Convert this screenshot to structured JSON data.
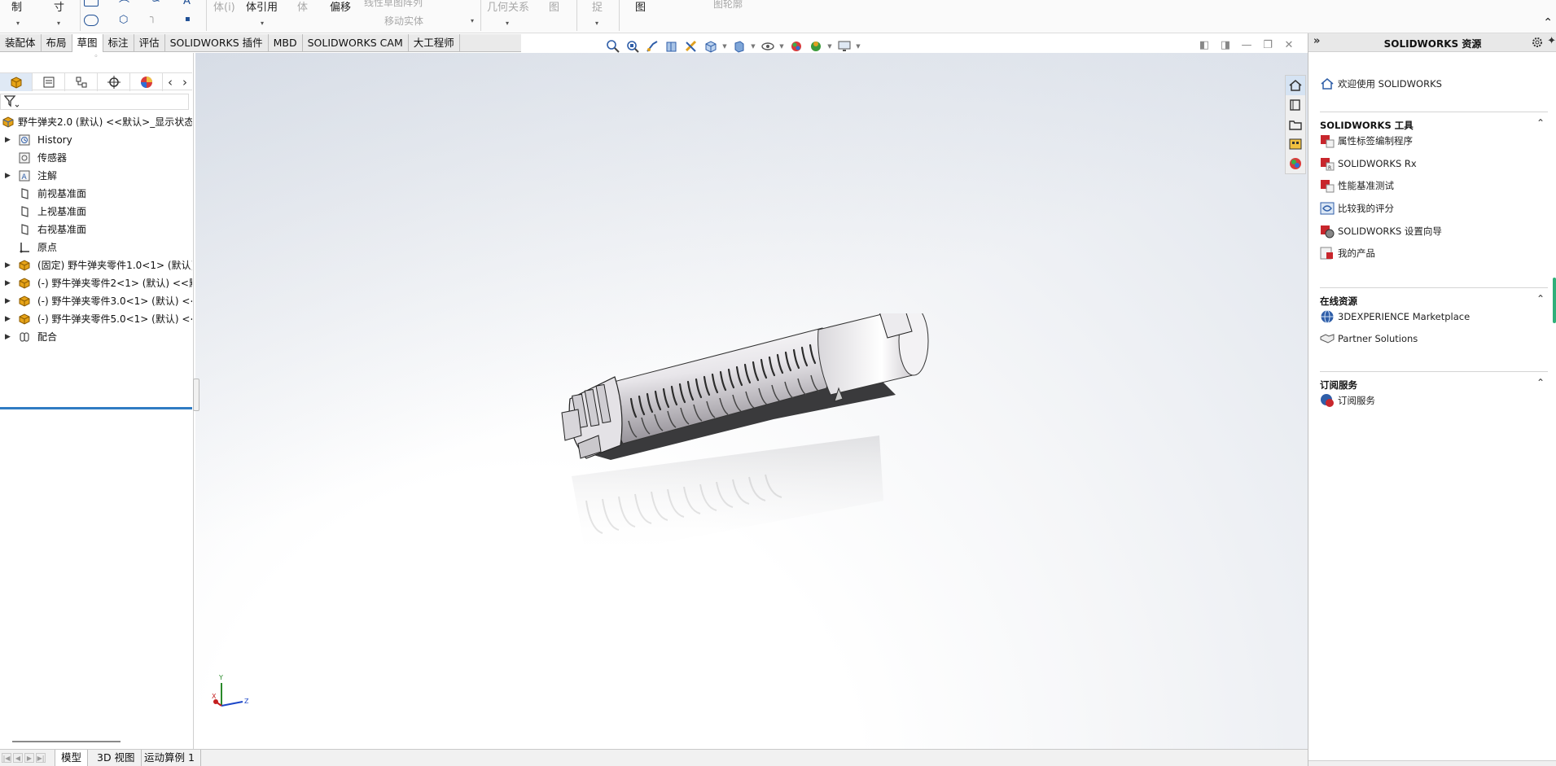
{
  "ribbon": {
    "items": [
      {
        "label": "制",
        "dim": false
      },
      {
        "label": "寸",
        "dim": false
      },
      {
        "label": "体(i)",
        "dim": true
      },
      {
        "label": "体引用",
        "dim": false
      },
      {
        "label": "体",
        "dim": true
      },
      {
        "label": "偏移",
        "dim": false
      },
      {
        "label": "线性草图阵列",
        "dim": true
      },
      {
        "label": "移动实体",
        "dim": true
      },
      {
        "label": "几何关系",
        "dim": true
      },
      {
        "label": "图",
        "dim": true
      },
      {
        "label": "捉",
        "dim": true
      },
      {
        "label": "图",
        "dim": false
      },
      {
        "label": "图轮廓",
        "dim": true
      }
    ]
  },
  "command_tabs": [
    {
      "label": "装配体",
      "active": false
    },
    {
      "label": "布局",
      "active": false
    },
    {
      "label": "草图",
      "active": true
    },
    {
      "label": "标注",
      "active": false
    },
    {
      "label": "评估",
      "active": false
    },
    {
      "label": "SOLIDWORKS 插件",
      "active": false
    },
    {
      "label": "MBD",
      "active": false
    },
    {
      "label": "SOLIDWORKS CAM",
      "active": false
    },
    {
      "label": "大工程师",
      "active": false
    }
  ],
  "hud_icons": [
    "zoom-to-fit-icon",
    "zoom-to-area-icon",
    "previous-view-icon",
    "section-view-icon",
    "dynamic-annotation-icon",
    "view-orientation-icon",
    "display-style-icon",
    "hide-show-items-icon",
    "edit-appearance-icon",
    "apply-scene-icon",
    "view-settings-icon"
  ],
  "feature_tree": {
    "root": "野牛弹夹2.0 (默认) <<默认>_显示状态",
    "nodes": [
      {
        "label": "History",
        "expandable": true,
        "icon": "history-icon"
      },
      {
        "label": "传感器",
        "expandable": false,
        "icon": "sensor-icon"
      },
      {
        "label": "注解",
        "expandable": true,
        "icon": "annotation-icon"
      },
      {
        "label": "前视基准面",
        "expandable": false,
        "icon": "plane-icon"
      },
      {
        "label": "上视基准面",
        "expandable": false,
        "icon": "plane-icon"
      },
      {
        "label": "右视基准面",
        "expandable": false,
        "icon": "plane-icon"
      },
      {
        "label": "原点",
        "expandable": false,
        "icon": "origin-icon"
      },
      {
        "label": "(固定) 野牛弹夹零件1.0<1> (默认)",
        "expandable": true,
        "icon": "part-icon"
      },
      {
        "label": "(-) 野牛弹夹零件2<1> (默认) <<默",
        "expandable": true,
        "icon": "part-icon"
      },
      {
        "label": "(-) 野牛弹夹零件3.0<1> (默认) <<",
        "expandable": true,
        "icon": "part-icon"
      },
      {
        "label": "(-) 野牛弹夹零件5.0<1> (默认) <<",
        "expandable": true,
        "icon": "part-icon"
      },
      {
        "label": "配合",
        "expandable": true,
        "icon": "mates-icon"
      }
    ]
  },
  "bottom_tabs": [
    {
      "label": "模型",
      "active": true
    },
    {
      "label": "3D 视图",
      "active": false
    },
    {
      "label": "运动算例 1",
      "active": false
    }
  ],
  "triad": {
    "x": "X",
    "y": "Y",
    "z": "Z"
  },
  "resources": {
    "title": "SOLIDWORKS 资源",
    "welcome": "欢迎使用 SOLIDWORKS",
    "sections": [
      {
        "title": "SOLIDWORKS 工具",
        "items": [
          "属性标签编制程序",
          "SOLIDWORKS Rx",
          "性能基准测试",
          "比较我的评分",
          "SOLIDWORKS 设置向导",
          "我的产品"
        ]
      },
      {
        "title": "在线资源",
        "items": [
          "3DEXPERIENCE Marketplace",
          "Partner Solutions"
        ]
      },
      {
        "title": "订阅服务",
        "items": [
          "订阅服务"
        ]
      }
    ]
  },
  "colors": {
    "accent_blue": "#2f7bc3",
    "icon_red": "#c8262c",
    "part_yellow": "#e6a317"
  }
}
